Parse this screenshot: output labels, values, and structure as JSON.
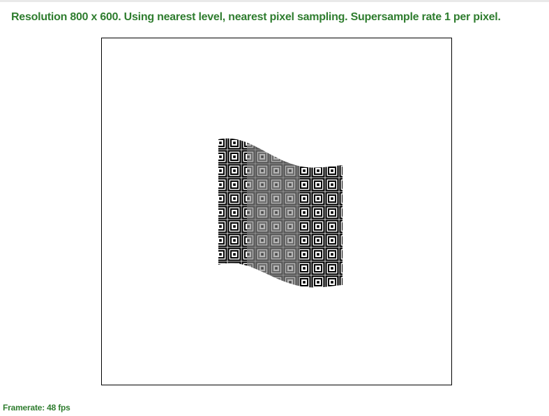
{
  "header": {
    "status_text": "Resolution 800 x 600. Using nearest level, nearest pixel sampling. Supersample rate 1 per pixel."
  },
  "footer": {
    "framerate_text": "Framerate: 48 fps"
  },
  "colors": {
    "text_green": "#2f7d2f",
    "viewport_border": "#000000",
    "texture_dark": "#000000",
    "texture_light": "#ffffff",
    "texture_mid_dark": "#555555",
    "texture_mid_light": "#b5b5b5"
  },
  "render": {
    "description_icons": [
      "wavy-textured-quad"
    ]
  }
}
